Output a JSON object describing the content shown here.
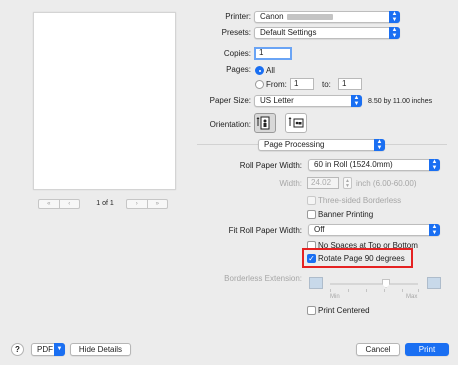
{
  "preview": {
    "page_indicator": "1 of 1",
    "first_icon": "double-chevron-left-icon",
    "prev_icon": "chevron-left-icon",
    "next_icon": "chevron-right-icon",
    "last_icon": "double-chevron-right-icon"
  },
  "printer": {
    "label": "Printer:",
    "value": "Canon"
  },
  "presets": {
    "label": "Presets:",
    "value": "Default Settings"
  },
  "copies": {
    "label": "Copies:",
    "value": "1"
  },
  "pages": {
    "label": "Pages:",
    "all_label": "All",
    "from_label": "From:",
    "from_value": "1",
    "to_label": "to:",
    "to_value": "1",
    "selected": "All"
  },
  "paper_size": {
    "label": "Paper Size:",
    "value": "US Letter",
    "dimensions": "8.50 by 11.00 inches"
  },
  "orientation": {
    "label": "Orientation:",
    "selected": "portrait"
  },
  "section": {
    "value": "Page Processing"
  },
  "roll_paper_width": {
    "label": "Roll Paper Width:",
    "value": "60 in Roll (1524.0mm)"
  },
  "width": {
    "label": "Width:",
    "value": "24.02",
    "unit_range": "inch (6.00-60.00)"
  },
  "three_sided_borderless": {
    "label": "Three-sided Borderless",
    "checked": false,
    "enabled": false
  },
  "banner_printing": {
    "label": "Banner Printing",
    "checked": false
  },
  "fit_roll_paper_width": {
    "label": "Fit Roll Paper Width:",
    "value": "Off"
  },
  "no_spaces": {
    "label": "No Spaces at Top or Bottom",
    "checked": false
  },
  "rotate_page": {
    "label": "Rotate Page 90 degrees",
    "checked": true
  },
  "borderless_extension": {
    "label": "Borderless Extension:",
    "min_label": "Min",
    "max_label": "Max",
    "level": 0.75
  },
  "print_centered": {
    "label": "Print Centered",
    "checked": false
  },
  "footer": {
    "help": "?",
    "pdf": "PDF",
    "hide_details": "Hide Details",
    "cancel": "Cancel",
    "print": "Print"
  },
  "colors": {
    "accent": "#1a6ff2",
    "highlight": "#e52222"
  }
}
